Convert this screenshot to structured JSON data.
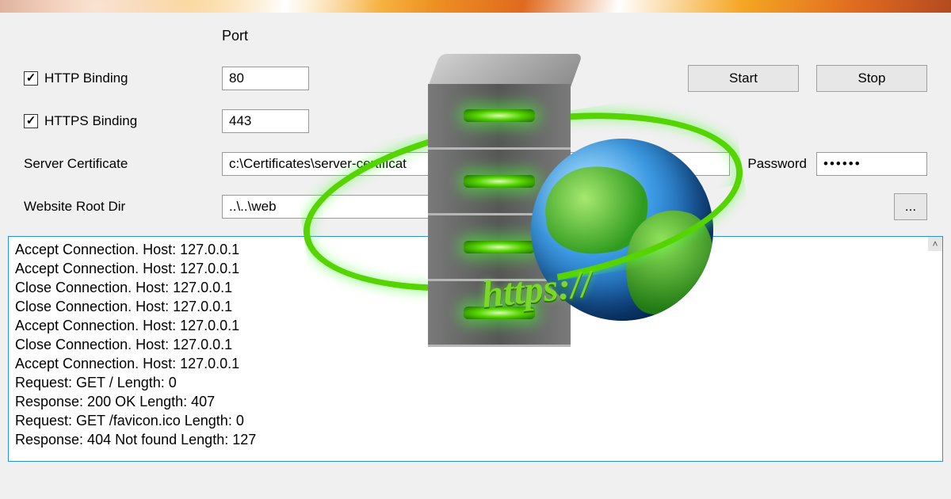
{
  "header": {
    "port_label": "Port"
  },
  "bindings": {
    "http": {
      "label": "HTTP Binding",
      "checked": true,
      "port": "80"
    },
    "https": {
      "label": "HTTPS Binding",
      "checked": true,
      "port": "443"
    }
  },
  "cert": {
    "label": "Server Certificate",
    "path": "c:\\Certificates\\server-certificat",
    "password_label": "Password",
    "password_mask": "••••••"
  },
  "rootdir": {
    "label": "Website Root Dir",
    "path": "..\\..\\web",
    "browse_label": "..."
  },
  "buttons": {
    "start": "Start",
    "stop": "Stop"
  },
  "illustration": {
    "https_text": "https://"
  },
  "log_lines": [
    "Accept Connection. Host: 127.0.0.1",
    "Accept Connection. Host: 127.0.0.1",
    "Close Connection. Host: 127.0.0.1",
    "Close Connection. Host: 127.0.0.1",
    "Accept Connection. Host: 127.0.0.1",
    "Close Connection. Host: 127.0.0.1",
    "Accept Connection. Host: 127.0.0.1",
    "Request: GET / Length: 0",
    "Response: 200 OK Length: 407",
    "Request: GET /favicon.ico Length: 0",
    "Response: 404 Not found Length: 127"
  ]
}
